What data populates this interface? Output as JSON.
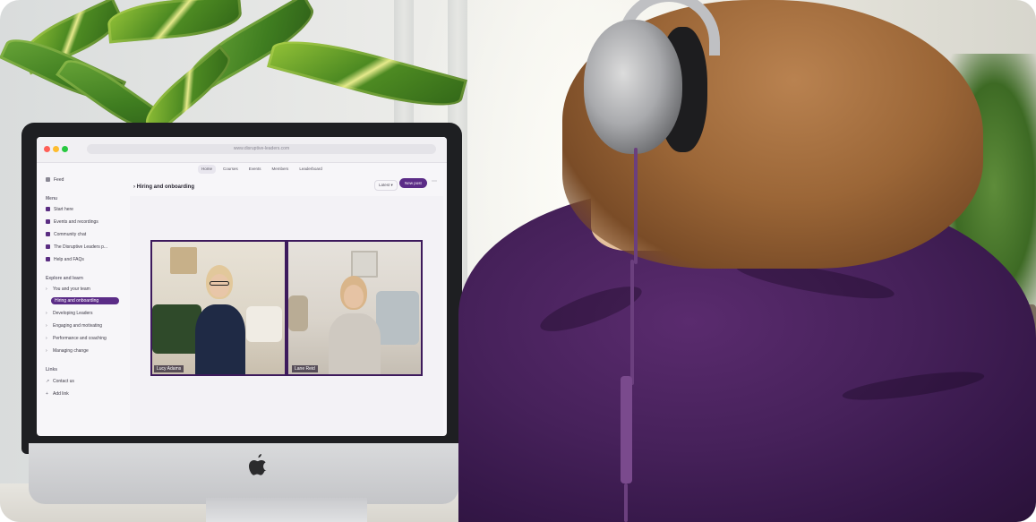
{
  "screen": {
    "url": "www.disruptive-leaders.com",
    "top_nav": [
      "Home",
      "Courses",
      "Events",
      "Members",
      "Leaderboard"
    ],
    "feed_label": "Feed",
    "menu_heading": "Menu",
    "menu_items": [
      "Start here",
      "Events and recordings",
      "Community chat",
      "The Disruptive Leaders p...",
      "Help and FAQs"
    ],
    "explore_heading": "Explore and learn",
    "explore_items": [
      "You and your team",
      "Hiring and onboarding",
      "Developing Leaders",
      "Engaging and motivating",
      "Performance and coaching",
      "Managing change"
    ],
    "links_heading": "Links",
    "link_items": [
      "Contact us",
      "Add link"
    ],
    "page_title": "Hiring and onboarding",
    "latest_label": "Latest",
    "new_post_label": "New post",
    "video_names": [
      "Lucy Adams",
      "Lane Reid"
    ]
  },
  "colors": {
    "accent": "#5b2c87",
    "shirt": "#46215a",
    "imac_bezel": "#1e1f22"
  }
}
